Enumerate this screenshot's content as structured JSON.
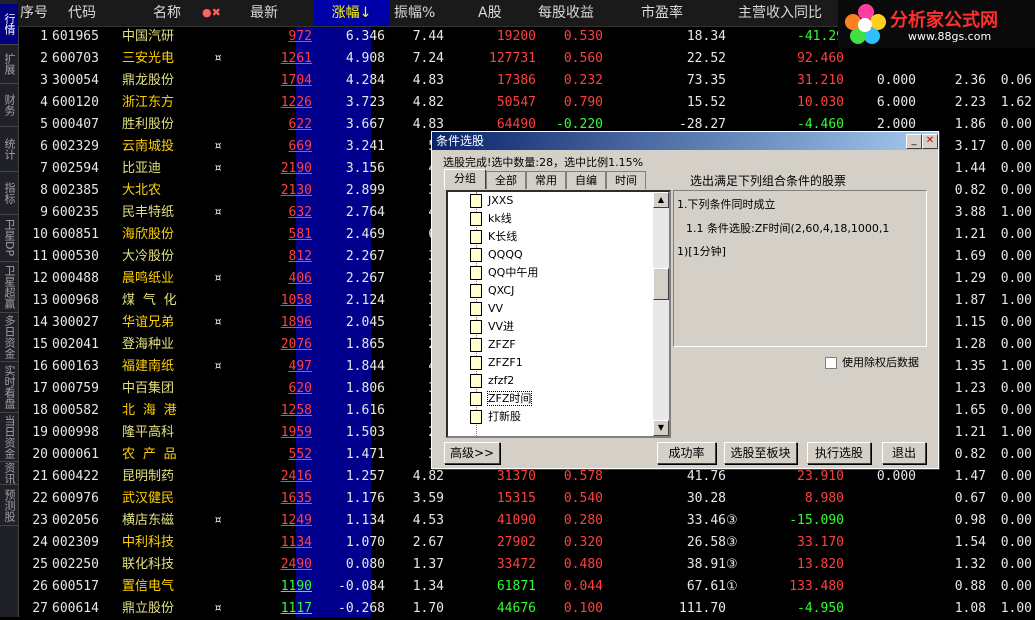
{
  "side_tabs": [
    "行情",
    "扩展",
    "财务",
    "统计",
    "指标",
    "卫星DP",
    "卫星超赢",
    "多日资金",
    "实时看盘",
    "当日资金",
    "资讯",
    "预测股"
  ],
  "header": {
    "cols": [
      "序号",
      "代码",
      "名称",
      "●✖",
      "最新",
      "涨幅↓",
      "振幅%",
      "A股",
      "每股收益",
      "市盈率",
      "主营收入同比"
    ]
  },
  "rows": [
    {
      "n": "1",
      "code": "601965",
      "name": "中国汽研",
      "mk": "",
      "p": "972",
      "chg": "6.346",
      "amp": "7.44",
      "a": "19200",
      "eps": "0.530",
      "pe": "18.34",
      "pe_mk": "",
      "rev": "-41.29",
      "e1": "",
      "e2": "",
      "e3": ""
    },
    {
      "n": "2",
      "code": "600703",
      "name": "三安光电",
      "mk": "¤",
      "p": "1261",
      "chg": "4.908",
      "amp": "7.24",
      "a": "127731",
      "eps": "0.560",
      "pe": "22.52",
      "pe_mk": "",
      "rev": "92.460",
      "e1": "",
      "e2": "",
      "e3": ""
    },
    {
      "n": "3",
      "code": "300054",
      "name": "鼎龙股份",
      "mk": "",
      "p": "1704",
      "chg": "4.284",
      "amp": "4.83",
      "a": "17386",
      "eps": "0.232",
      "pe": "73.35",
      "pe_mk": "",
      "rev": "31.210",
      "e1": "0.000",
      "e2": "2.36",
      "e3": "0.06"
    },
    {
      "n": "4",
      "code": "600120",
      "name": "浙江东方",
      "mk": "",
      "p": "1226",
      "chg": "3.723",
      "amp": "4.82",
      "a": "50547",
      "eps": "0.790",
      "pe": "15.52",
      "pe_mk": "",
      "rev": "10.030",
      "e1": "6.000",
      "e2": "2.23",
      "e3": "1.62"
    },
    {
      "n": "5",
      "code": "000407",
      "name": "胜利股份",
      "mk": "",
      "p": "622",
      "chg": "3.667",
      "amp": "4.83",
      "a": "64490",
      "eps": "-0.220",
      "pe": "-28.27",
      "pe_mk": "",
      "rev": "-4.460",
      "e1": "2.000",
      "e2": "1.86",
      "e3": "0.00"
    },
    {
      "n": "6",
      "code": "002329",
      "name": "云南城投",
      "mk": "¤",
      "p": "669",
      "chg": "3.241",
      "amp": "5.",
      "a": "",
      "eps": "",
      "pe": "",
      "pe_mk": "",
      "rev": "",
      "e1": "",
      "e2": "3.17",
      "e3": "0.00"
    },
    {
      "n": "7",
      "code": "002594",
      "name": "比亚迪",
      "mk": "¤",
      "p": "2190",
      "chg": "3.156",
      "amp": "4.",
      "a": "",
      "eps": "",
      "pe": "",
      "pe_mk": "",
      "rev": "",
      "e1": "",
      "e2": "1.44",
      "e3": "0.00"
    },
    {
      "n": "8",
      "code": "002385",
      "name": "大北农",
      "mk": "",
      "p": "2130",
      "chg": "2.899",
      "amp": "3.",
      "a": "",
      "eps": "",
      "pe": "",
      "pe_mk": "",
      "rev": "",
      "e1": "",
      "e2": "0.82",
      "e3": "0.00"
    },
    {
      "n": "9",
      "code": "600235",
      "name": "民丰特纸",
      "mk": "¤",
      "p": "632",
      "chg": "2.764",
      "amp": "4.",
      "a": "",
      "eps": "",
      "pe": "",
      "pe_mk": "",
      "rev": "",
      "e1": "",
      "e2": "3.88",
      "e3": "1.00"
    },
    {
      "n": "10",
      "code": "600851",
      "name": "海欣股份",
      "mk": "",
      "p": "581",
      "chg": "2.469",
      "amp": "6.",
      "a": "",
      "eps": "",
      "pe": "",
      "pe_mk": "",
      "rev": "",
      "e1": "",
      "e2": "1.21",
      "e3": "0.00"
    },
    {
      "n": "11",
      "code": "000530",
      "name": "大冷股份",
      "mk": "",
      "p": "812",
      "chg": "2.267",
      "amp": "3.",
      "a": "",
      "eps": "",
      "pe": "",
      "pe_mk": "",
      "rev": "",
      "e1": "",
      "e2": "1.69",
      "e3": "0.00"
    },
    {
      "n": "12",
      "code": "000488",
      "name": "晨鸣纸业",
      "mk": "¤",
      "p": "406",
      "chg": "2.267",
      "amp": "3.",
      "a": "",
      "eps": "",
      "pe": "",
      "pe_mk": "",
      "rev": "",
      "e1": "",
      "e2": "1.29",
      "e3": "0.00"
    },
    {
      "n": "13",
      "code": "000968",
      "name": "煤 气 化",
      "mk": "",
      "p": "1058",
      "chg": "2.124",
      "amp": "3.",
      "a": "",
      "eps": "",
      "pe": "",
      "pe_mk": "",
      "rev": "",
      "e1": "",
      "e2": "1.87",
      "e3": "1.00"
    },
    {
      "n": "14",
      "code": "300027",
      "name": "华谊兄弟",
      "mk": "¤",
      "p": "1896",
      "chg": "2.045",
      "amp": "3.",
      "a": "",
      "eps": "",
      "pe": "",
      "pe_mk": "",
      "rev": "",
      "e1": "",
      "e2": "1.15",
      "e3": "0.00"
    },
    {
      "n": "15",
      "code": "002041",
      "name": "登海种业",
      "mk": "",
      "p": "2076",
      "chg": "1.865",
      "amp": "2.",
      "a": "",
      "eps": "",
      "pe": "",
      "pe_mk": "",
      "rev": "",
      "e1": "",
      "e2": "1.28",
      "e3": "0.00"
    },
    {
      "n": "16",
      "code": "600163",
      "name": "福建南纸",
      "mk": "¤",
      "p": "497",
      "chg": "1.844",
      "amp": "4.",
      "a": "",
      "eps": "",
      "pe": "",
      "pe_mk": "",
      "rev": "",
      "e1": "",
      "e2": "1.35",
      "e3": "1.00"
    },
    {
      "n": "17",
      "code": "000759",
      "name": "中百集团",
      "mk": "",
      "p": "620",
      "chg": "1.806",
      "amp": "3.",
      "a": "",
      "eps": "",
      "pe": "",
      "pe_mk": "",
      "rev": "",
      "e1": "",
      "e2": "1.23",
      "e3": "0.00"
    },
    {
      "n": "18",
      "code": "000582",
      "name": "北 海 港",
      "mk": "",
      "p": "1258",
      "chg": "1.616",
      "amp": "3.",
      "a": "",
      "eps": "",
      "pe": "",
      "pe_mk": "",
      "rev": "",
      "e1": "",
      "e2": "1.65",
      "e3": "0.00"
    },
    {
      "n": "19",
      "code": "000998",
      "name": "隆平高科",
      "mk": "",
      "p": "1959",
      "chg": "1.503",
      "amp": "2.",
      "a": "",
      "eps": "",
      "pe": "",
      "pe_mk": "",
      "rev": "",
      "e1": "",
      "e2": "1.21",
      "e3": "1.00"
    },
    {
      "n": "20",
      "code": "000061",
      "name": "农 产 品",
      "mk": "",
      "p": "552",
      "chg": "1.471",
      "amp": "3.",
      "a": "",
      "eps": "",
      "pe": "",
      "pe_mk": "",
      "rev": "",
      "e1": "",
      "e2": "0.82",
      "e3": "0.00"
    },
    {
      "n": "21",
      "code": "600422",
      "name": "昆明制药",
      "mk": "",
      "p": "2416",
      "chg": "1.257",
      "amp": "4.82",
      "a": "31370",
      "eps": "0.578",
      "pe": "41.76",
      "pe_mk": "",
      "rev": "23.910",
      "e1": "0.000",
      "e2": "1.47",
      "e3": "0.00"
    },
    {
      "n": "22",
      "code": "600976",
      "name": "武汉健民",
      "mk": "",
      "p": "1635",
      "chg": "1.176",
      "amp": "3.59",
      "a": "15315",
      "eps": "0.540",
      "pe": "30.28",
      "pe_mk": "",
      "rev": "8.980",
      "e1": "",
      "e2": "0.67",
      "e3": "0.00"
    },
    {
      "n": "23",
      "code": "002056",
      "name": "横店东磁",
      "mk": "¤",
      "p": "1249",
      "chg": "1.134",
      "amp": "4.53",
      "a": "41090",
      "eps": "0.280",
      "pe": "33.46",
      "pe_mk": "③",
      "rev": "-15.090",
      "e1": "",
      "e2": "0.98",
      "e3": "0.00"
    },
    {
      "n": "24",
      "code": "002309",
      "name": "中利科技",
      "mk": "",
      "p": "1134",
      "chg": "1.070",
      "amp": "2.67",
      "a": "27902",
      "eps": "0.320",
      "pe": "26.58",
      "pe_mk": "③",
      "rev": "33.170",
      "e1": "",
      "e2": "1.54",
      "e3": "0.00"
    },
    {
      "n": "25",
      "code": "002250",
      "name": "联化科技",
      "mk": "",
      "p": "2490",
      "chg": "0.080",
      "amp": "1.37",
      "a": "33472",
      "eps": "0.480",
      "pe": "38.91",
      "pe_mk": "③",
      "rev": "13.820",
      "e1": "",
      "e2": "1.32",
      "e3": "0.00"
    },
    {
      "n": "26",
      "code": "600517",
      "name": "置信电气",
      "mk": "",
      "p": "1190",
      "chg": "-0.084",
      "amp": "1.34",
      "a": "61871",
      "eps": "0.044",
      "pe": "67.61",
      "pe_mk": "①",
      "rev": "133.480",
      "e1": "",
      "e2": "0.88",
      "e3": "0.00"
    },
    {
      "n": "27",
      "code": "600614",
      "name": "鼎立股份",
      "mk": "¤",
      "p": "1117",
      "chg": "-0.268",
      "amp": "1.70",
      "a": "44676",
      "eps": "0.100",
      "pe": "111.70",
      "pe_mk": "",
      "rev": "-4.950",
      "e1": "",
      "e2": "1.08",
      "e3": "1.00"
    }
  ],
  "logo": {
    "name": "分析家公式网",
    "url": "www.88gs.com"
  },
  "dialog": {
    "title": "条件选股",
    "status": "选股完成!选中数量:28，选中比例1.15%",
    "tabs": [
      "分组",
      "全部",
      "常用",
      "自编",
      "时间"
    ],
    "tree_items": [
      "JXXS",
      "kk线",
      "K长线",
      "QQQQ",
      "QQ中午用",
      "QXCJ",
      "VV",
      "VV进",
      "ZFZF",
      "ZFZF1",
      "zfzf2",
      "ZFZ时间",
      "打新股"
    ],
    "right_label": "选出满足下列组合条件的股票",
    "cond_lines": [
      "1.下列条件同时成立",
      "1.1 条件选股:ZF时间(2,60,4,18,1000,1",
      "1)[1分钟]"
    ],
    "checkbox_label": "使用除权后数据",
    "buttons": {
      "advanced": "高级>>",
      "rate": "成功率",
      "to_block": "选股至板块",
      "execute": "执行选股",
      "exit": "退出"
    }
  }
}
